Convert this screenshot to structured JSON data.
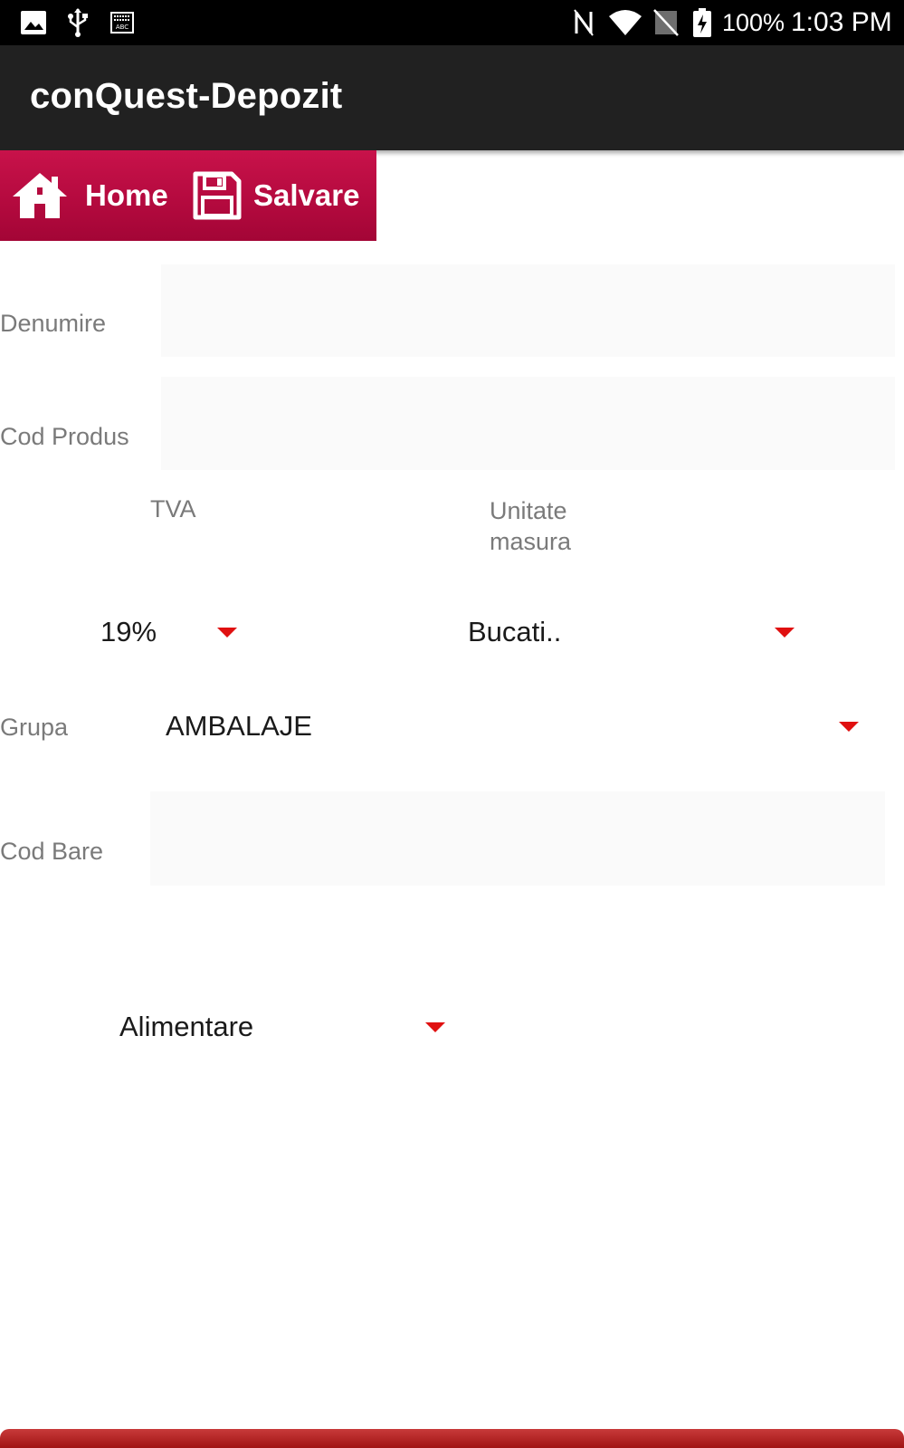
{
  "status_bar": {
    "battery": "100%",
    "time": "1:03 PM",
    "icons": [
      "image-icon",
      "usb-icon",
      "keyboard-icon",
      "nfc-icon",
      "wifi-icon",
      "no-sim-icon",
      "battery-icon"
    ]
  },
  "app_bar": {
    "title": "conQuest-Depozit"
  },
  "toolbar": {
    "home_label": "Home",
    "save_label": "Salvare",
    "accent": "#b50a3f"
  },
  "form": {
    "denumire": {
      "label": "Denumire",
      "value": ""
    },
    "cod_produs": {
      "label": "Cod Produs",
      "value": ""
    },
    "tva": {
      "label": "TVA",
      "selected": "19%"
    },
    "unitate_masura": {
      "label_line1": "Unitate",
      "label_line2": "masura",
      "selected": "Bucati.."
    },
    "grupa": {
      "label": "Grupa",
      "selected": "AMBALAJE"
    },
    "cod_bare": {
      "label": "Cod Bare",
      "value": ""
    },
    "categorie": {
      "selected": "Alimentare"
    }
  },
  "colors": {
    "caret": "#e01010",
    "statusbar": "#000000",
    "appbar": "#212121"
  }
}
